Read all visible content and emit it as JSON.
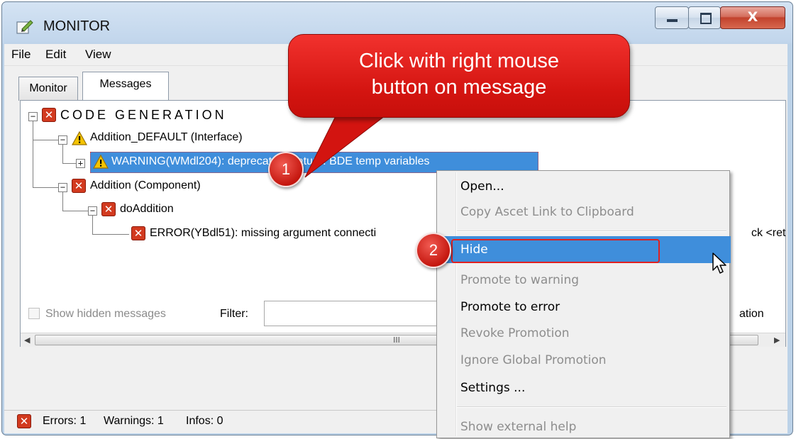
{
  "window": {
    "title": "MONITOR",
    "close_glyph": "X"
  },
  "menu": {
    "items": [
      "File",
      "Edit",
      "View"
    ]
  },
  "tabs": [
    {
      "label": "Monitor",
      "active": false
    },
    {
      "label": "Messages",
      "active": true
    }
  ],
  "tree": {
    "root": {
      "label": "CODE GENERATION",
      "icon": "error-icon"
    },
    "interface_node": {
      "label": "Addition_DEFAULT (Interface)",
      "icon": "warning-icon"
    },
    "warning_message": {
      "prefix": "WARNING(WMdl204): ",
      "rest": "deprecated feature: BDE temp variables",
      "icon": "warning-icon",
      "selected": true
    },
    "component_node": {
      "label": "Addition (Component)",
      "icon": "error-icon"
    },
    "method_node": {
      "label": "doAddition",
      "icon": "error-icon"
    },
    "error_message": {
      "label": "ERROR(YBdl51): missing argument connecti",
      "trailing": "ck <ret",
      "icon": "error-icon"
    },
    "scroll_glyph": "III"
  },
  "filter_row": {
    "show_hidden_label": "Show hidden messages",
    "show_hidden_checked": false,
    "filter_label": "Filter:",
    "filter_value": "",
    "right_button_text": "ation"
  },
  "status": {
    "icon": "error-icon",
    "errors": "Errors: 1",
    "warnings": "Warnings: 1",
    "infos": "Infos: 0"
  },
  "context_menu": {
    "items": [
      {
        "label": "Open...",
        "enabled": true
      },
      {
        "label": "Copy Ascet Link to Clipboard",
        "enabled": false
      },
      {
        "label": "Hide",
        "enabled": true,
        "highlighted": true
      },
      {
        "label": "Promote to warning",
        "enabled": false
      },
      {
        "label": "Promote to error",
        "enabled": true
      },
      {
        "label": "Revoke Promotion",
        "enabled": false
      },
      {
        "label": "Ignore Global Promotion",
        "enabled": false
      },
      {
        "label": "Settings ...",
        "enabled": true
      },
      {
        "label": "Show external help",
        "enabled": false
      }
    ]
  },
  "annotations": {
    "callout_line1": "Click with right mouse",
    "callout_line2": "button on message",
    "step1": "1",
    "step2": "2"
  },
  "colors": {
    "callout_red": "#d31410",
    "highlight_blue": "#3f8edb",
    "error_red": "#d23a1f",
    "warning_yellow": "#f5c400"
  }
}
